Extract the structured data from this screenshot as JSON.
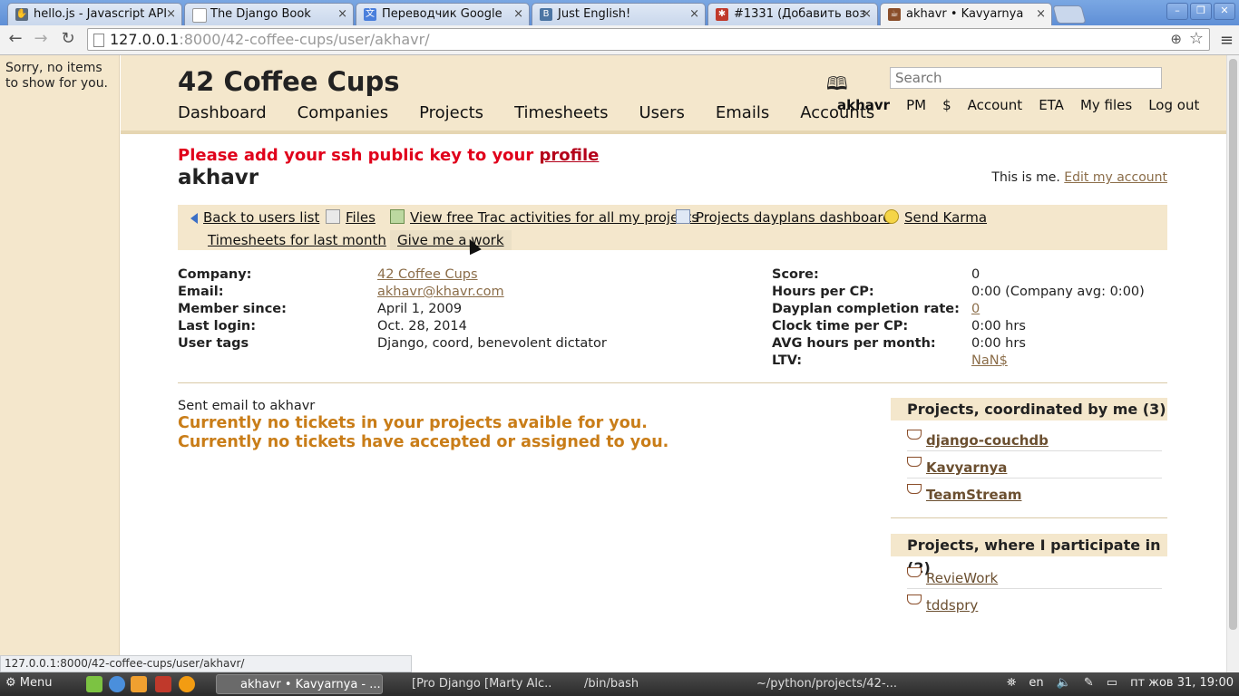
{
  "browser": {
    "tabs": [
      {
        "title": "hello.js - Javascript API",
        "icon": "hand-icon",
        "color": "#5b6b7d"
      },
      {
        "title": "The Django Book",
        "icon": "page-icon",
        "color": "#ffffff"
      },
      {
        "title": "Переводчик Google",
        "icon": "google-translate-icon",
        "color": "#4a7fdc"
      },
      {
        "title": "Just English!",
        "icon": "vk-icon",
        "color": "#4c75a3"
      },
      {
        "title": "#1331 (Добавить воз",
        "icon": "bug-icon",
        "color": "#c0392b"
      },
      {
        "title": "akhavr • Kavyarnya",
        "icon": "coffee-cup-icon",
        "color": "#8a4e2a"
      }
    ],
    "url_host": "127.0.0.1",
    "url_rest": ":8000/42-coffee-cups/user/akhavr/",
    "status_url": "127.0.0.1:8000/42-coffee-cups/user/akhavr/"
  },
  "sidebar": {
    "empty_text": "Sorry, no items to show for you."
  },
  "header": {
    "site_title": "42 Coffee Cups",
    "main_nav": [
      "Dashboard",
      "Companies",
      "Projects",
      "Timesheets",
      "Users",
      "Emails",
      "Accounts"
    ],
    "search_placeholder": "Search",
    "user_nav": [
      "akhavr",
      "PM",
      "$",
      "Account",
      "ETA",
      "My files",
      "Log out"
    ]
  },
  "content": {
    "ssh_warning_prefix": "Please add your ssh public key to your ",
    "ssh_warning_link": "profile",
    "username": "akhavr",
    "this_is_me": "This is me.",
    "edit_account": "Edit my account",
    "actions": [
      "Back to users list",
      "Files",
      "View free Trac activities for all my projects",
      "Projects dayplans dashboard",
      "Send Karma",
      "Timesheets for last month",
      "Give me a work"
    ],
    "info_left": [
      {
        "label": "Company:",
        "value": "42 Coffee Cups",
        "link": true
      },
      {
        "label": "Email:",
        "value": "akhavr@khavr.com",
        "link": true
      },
      {
        "label": "Member since:",
        "value": "April 1, 2009",
        "link": false
      },
      {
        "label": "Last login:",
        "value": "Oct. 28, 2014",
        "link": false
      },
      {
        "label": "User tags",
        "value": "Django, coord, benevolent dictator",
        "link": false
      }
    ],
    "info_right": [
      {
        "label": "Score:",
        "value": "0",
        "link": false
      },
      {
        "label": "Hours per CP:",
        "value": "0:00 (Company avg: 0:00)",
        "link": false
      },
      {
        "label": "Dayplan completion rate:",
        "value": "0",
        "link": true
      },
      {
        "label": "Clock time per CP:",
        "value": "0:00 hrs",
        "link": false
      },
      {
        "label": "AVG hours per month:",
        "value": "0:00 hrs",
        "link": false
      },
      {
        "label": "LTV:",
        "value": "NaN$",
        "link": true
      }
    ],
    "sent_email": "Sent email to akhavr",
    "notice1": "Currently no tickets in your projects avaible for you.",
    "notice2": "Currently no tickets have accepted or assigned to you.",
    "coordinated": {
      "title": "Projects, coordinated by me (3)",
      "items": [
        "django-couchdb",
        "Kavyarnya",
        "TeamStream"
      ]
    },
    "participate": {
      "title": "Projects, where I participate in (2)",
      "items": [
        "RevieWork",
        "tddspry"
      ]
    }
  },
  "taskbar": {
    "menu_label": "Menu",
    "tasks": [
      "akhavr • Kavyarnya - ...",
      "[Pro Django [Marty Alc...",
      "/bin/bash",
      "~/python/projects/42-..."
    ],
    "lang": "en",
    "clock": "пт жов 31, 19:00"
  }
}
